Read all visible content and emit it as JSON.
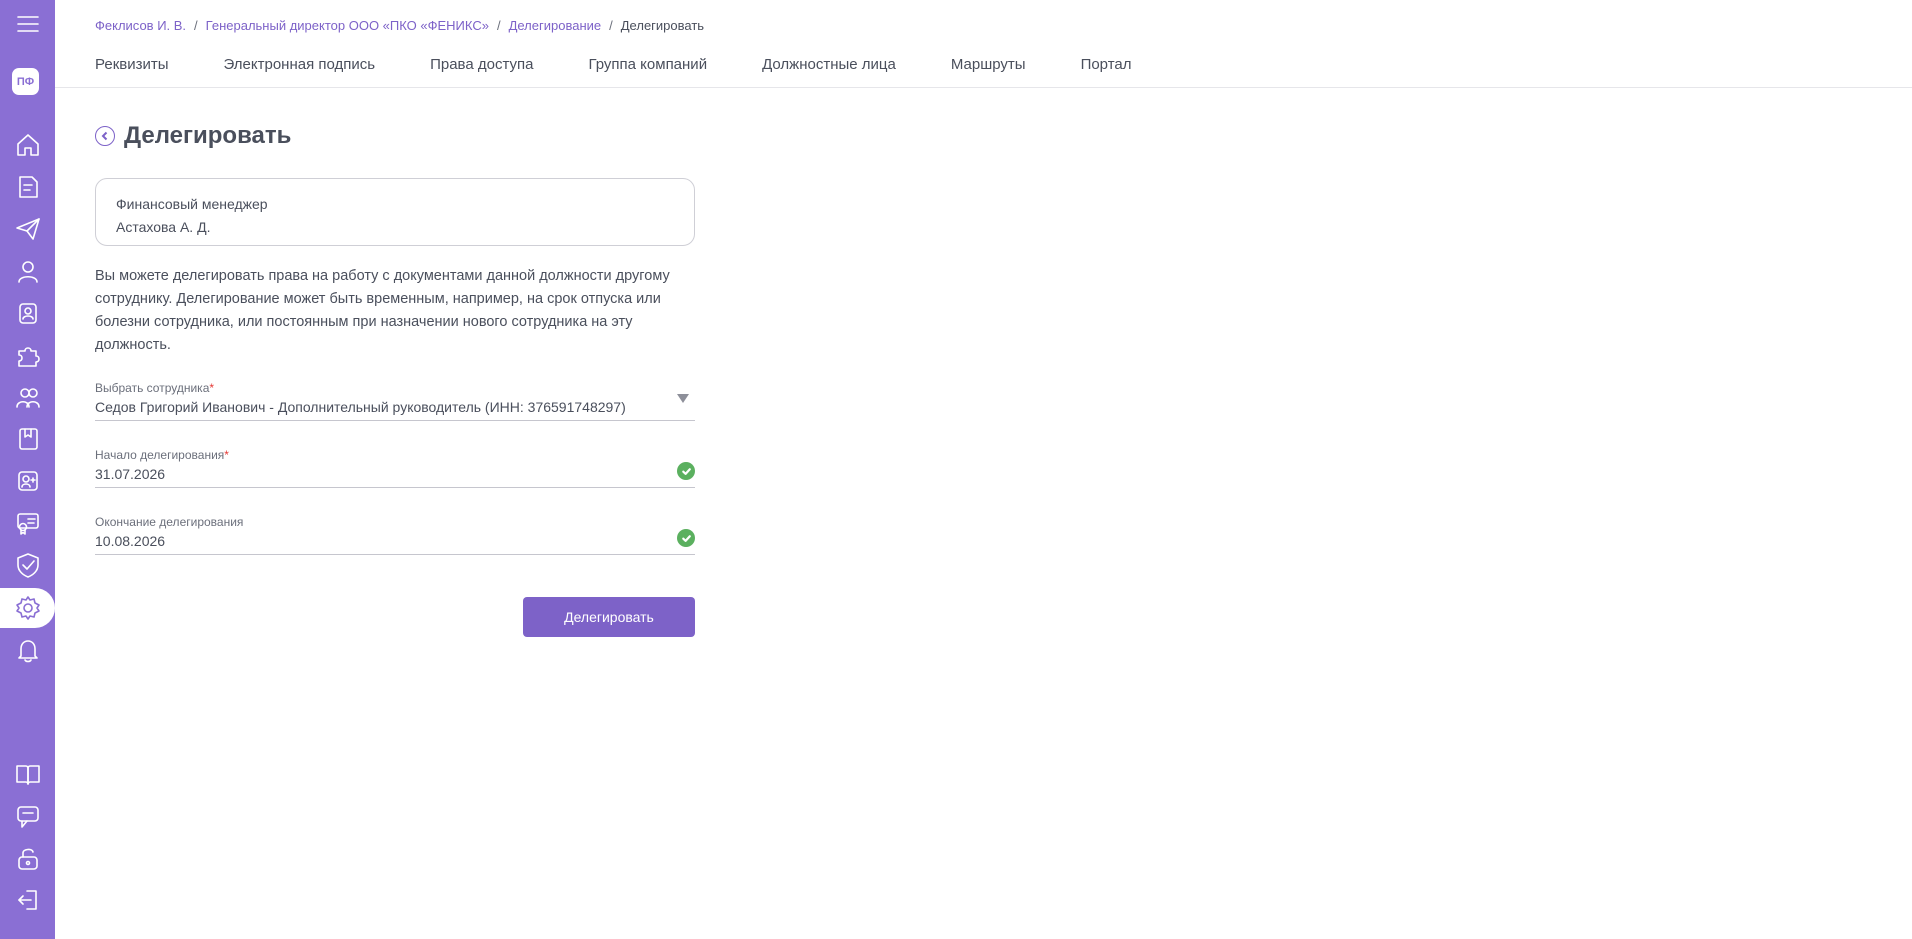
{
  "sidebar": {
    "avatar_initials": "ПФ",
    "accent": "#8a6fd4",
    "icons": [
      "menu-icon",
      "home-icon",
      "document-icon",
      "send-icon",
      "user-icon",
      "badge-icon",
      "puzzle-icon",
      "group-icon",
      "book-icon",
      "add-contact-icon",
      "certificate-icon",
      "shield-icon",
      "gear-icon",
      "bell-icon",
      "open-book-icon",
      "chat-icon",
      "unlock-icon",
      "logout-icon"
    ],
    "active": "gear-icon"
  },
  "breadcrumb": {
    "items": [
      "Феклисов И. В.",
      "Генеральный директор ООО «ПКО «ФЕНИКС»",
      "Делегирование"
    ],
    "current": "Делегировать",
    "separator": "/"
  },
  "tabs": [
    "Реквизиты",
    "Электронная подпись",
    "Права доступа",
    "Группа компаний",
    "Должностные лица",
    "Маршруты",
    "Портал"
  ],
  "page": {
    "title": "Делегировать"
  },
  "position_card": {
    "position": "Финансовый менеджер",
    "person": "Астахова А. Д."
  },
  "description": "Вы можете делегировать права на работу с документами данной должности другому сотруднику. Делегирование может быть временным, например, на срок отпуска или болезни сотрудника, или постоянным при назначении нового сотрудника на эту должность.",
  "form": {
    "employee": {
      "label": "Выбрать сотрудника",
      "required_mark": "*",
      "value": "Седов Григорий Иванович - Дополнительный руководитель (ИНН: 376591748297)"
    },
    "start": {
      "label": "Начало делегирования",
      "required_mark": "*",
      "value": "31.07.2026"
    },
    "end": {
      "label": "Окончание делегирования",
      "value": "10.08.2026"
    },
    "submit_label": "Делегировать"
  }
}
